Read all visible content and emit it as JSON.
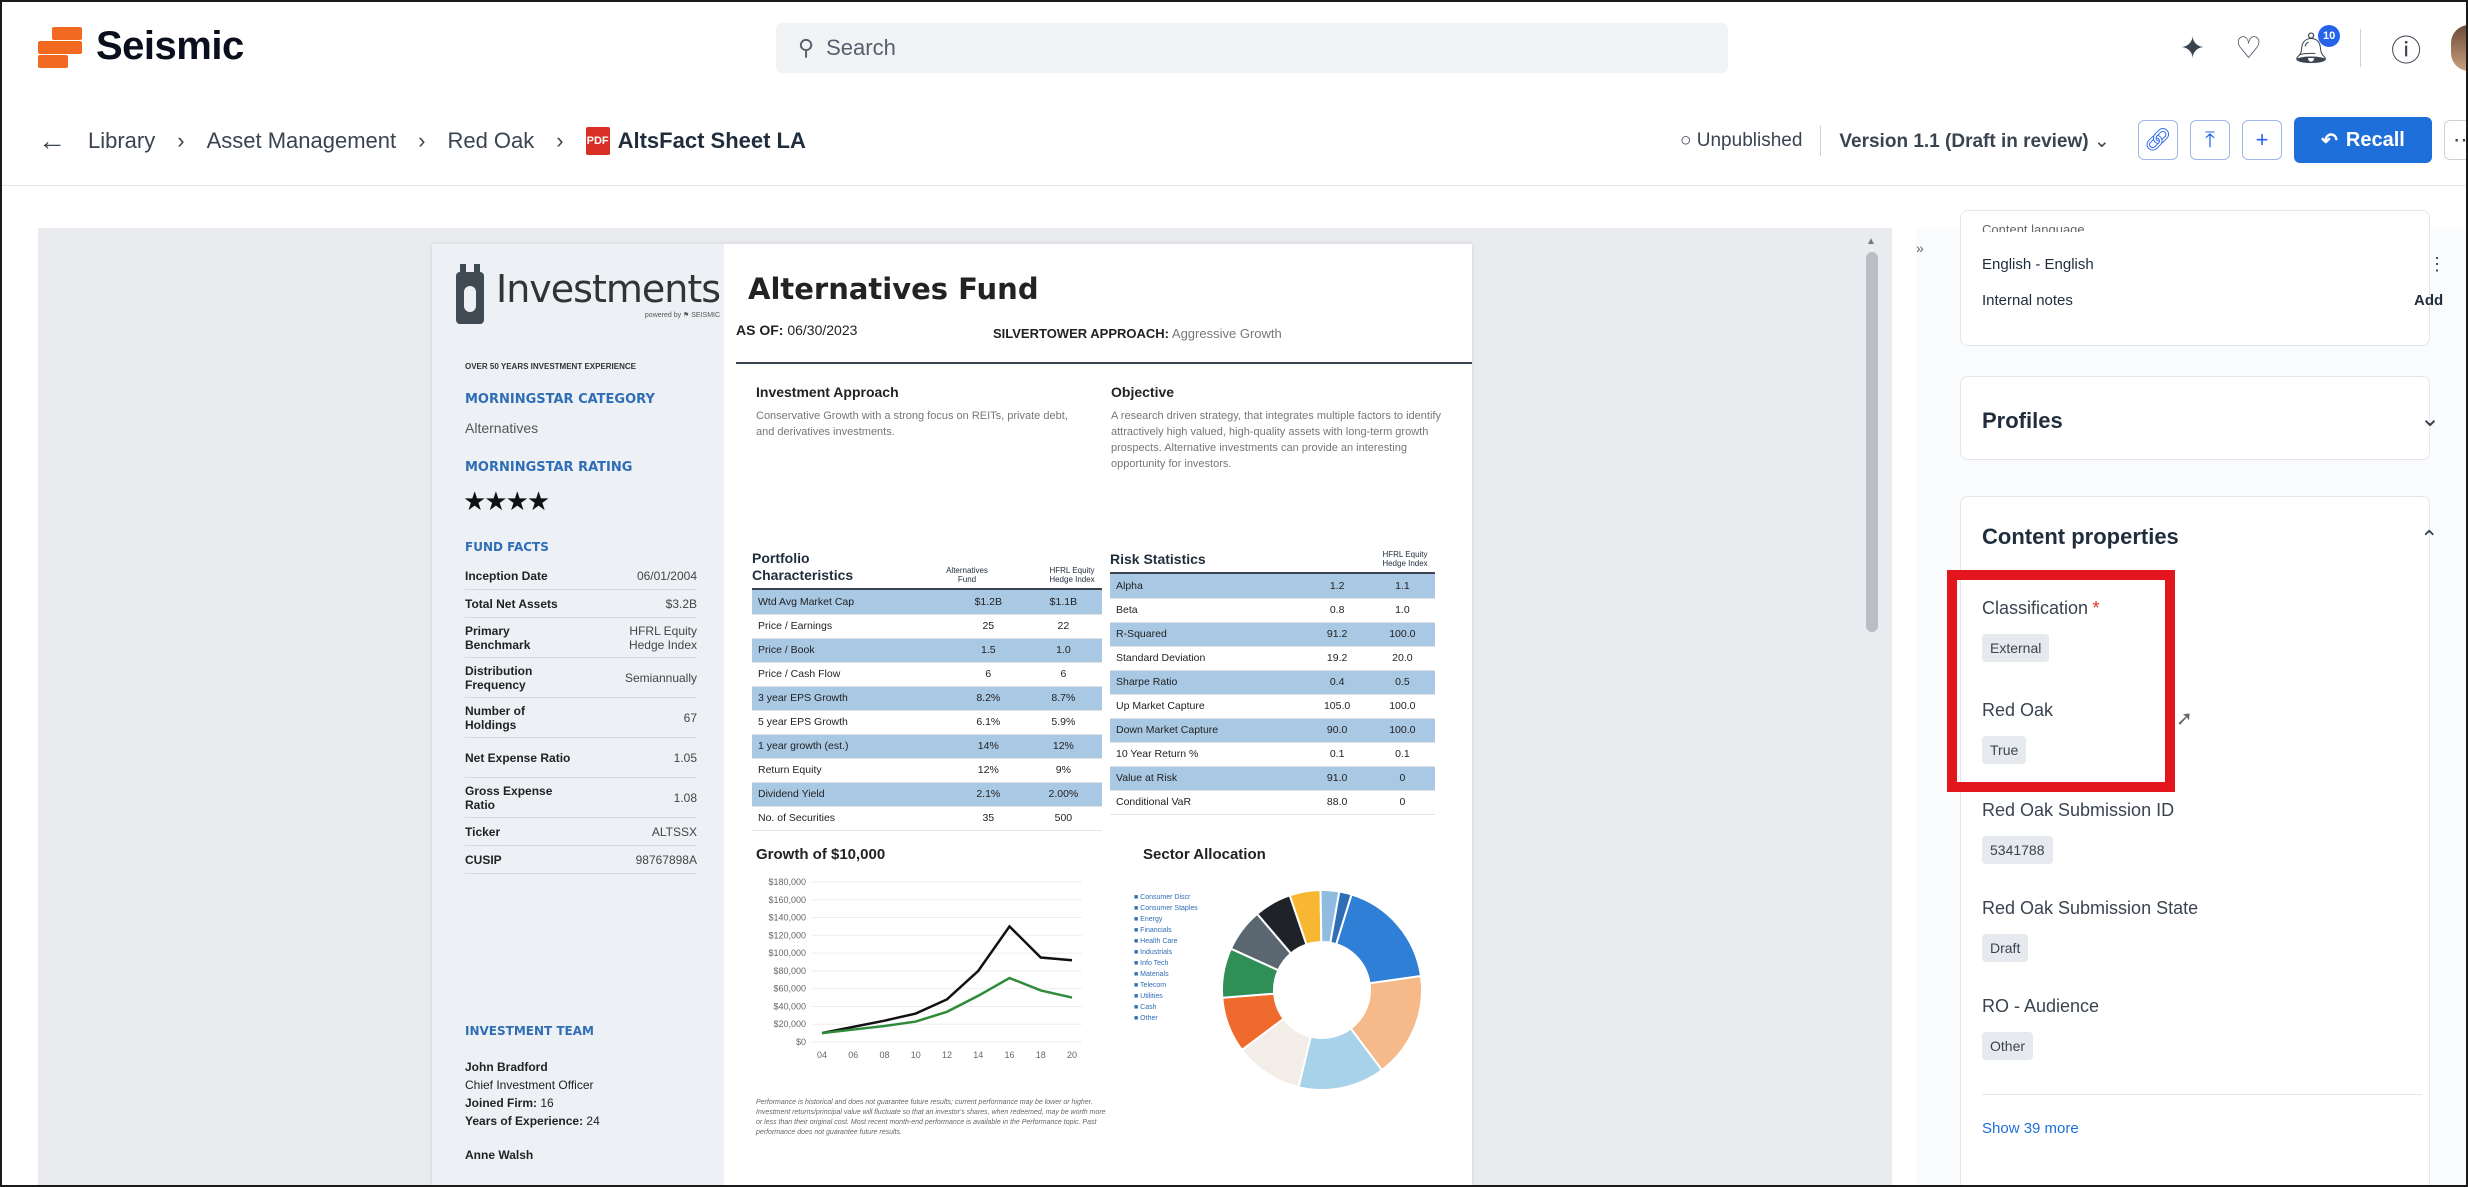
{
  "app": {
    "brand": "Seismic",
    "search_placeholder": "Search",
    "notif_count": "10"
  },
  "breadcrumb": [
    "Library",
    "Asset Management",
    "Red Oak"
  ],
  "document": {
    "title": "AltsFact Sheet LA",
    "status": "Unpublished",
    "version": "Version 1.1 (Draft in review)"
  },
  "toolbar": {
    "recall": "Recall"
  },
  "sheet": {
    "brand": "Investments",
    "brand_sub": "powered by ⚑ SEISMIC",
    "title": "Alternatives Fund",
    "as_of_label": "AS OF:",
    "as_of": "06/30/2023",
    "approach_label": "SILVERTOWER APPROACH:",
    "approach": "Aggressive Growth",
    "experience": "OVER 50 YEARS INVESTMENT EXPERIENCE",
    "category_label": "MORNINGSTAR CATEGORY",
    "category": "Alternatives",
    "rating_label": "MORNINGSTAR RATING",
    "rating_stars": "★★★★",
    "facts_label": "FUND FACTS",
    "facts": [
      [
        "Inception Date",
        "06/01/2004"
      ],
      [
        "Total Net Assets",
        "$3.2B"
      ],
      [
        "Primary Benchmark",
        "HFRL Equity Hedge Index"
      ],
      [
        "Distribution Frequency",
        "Semiannually"
      ],
      [
        "Number of Holdings",
        "67"
      ],
      [
        "Net Expense Ratio",
        "1.05"
      ],
      [
        "Gross Expense Ratio",
        "1.08"
      ],
      [
        "Ticker",
        "ALTSSX"
      ],
      [
        "CUSIP",
        "98767898A"
      ]
    ],
    "team_label": "INVESTMENT TEAM",
    "team": [
      {
        "name": "John Bradford",
        "role": "Chief Investment Officer",
        "joined_label": "Joined Firm:",
        "joined": "16",
        "years_label": "Years of Experience:",
        "years": "24"
      },
      {
        "name": "Anne Walsh"
      }
    ],
    "approach_head": "Investment Approach",
    "approach_text": "Conservative Growth with a strong focus on REITs, private debt, and derivatives investments.",
    "objective_head": "Objective",
    "objective_text": "A research driven strategy, that integrates multiple factors to identify attractively high valued, high-quality assets with long-term growth prospects. Alternative investments can provide an interesting opportunity for investors.",
    "portfolio_head": "Portfolio Characteristics",
    "portfolio_cols": [
      "Alternatives Fund",
      "HFRL Equity Hedge Index"
    ],
    "portfolio_rows": [
      [
        "Wtd Avg Market Cap",
        "$1.2B",
        "$1.1B"
      ],
      [
        "Price / Earnings",
        "25",
        "22"
      ],
      [
        "Price / Book",
        "1.5",
        "1.0"
      ],
      [
        "Price / Cash Flow",
        "6",
        "6"
      ],
      [
        "3 year EPS Growth",
        "8.2%",
        "8.7%"
      ],
      [
        "5 year EPS Growth",
        "6.1%",
        "5.9%"
      ],
      [
        "1 year growth (est.)",
        "14%",
        "12%"
      ],
      [
        "Return Equity",
        "12%",
        "9%"
      ],
      [
        "Dividend Yield",
        "2.1%",
        "2.00%"
      ],
      [
        "No. of Securities",
        "35",
        "500"
      ]
    ],
    "risk_head": "Risk Statistics",
    "risk_col": "HFRL Equity Hedge Index",
    "risk_rows": [
      [
        "Alpha",
        "1.2",
        "1.1"
      ],
      [
        "Beta",
        "0.8",
        "1.0"
      ],
      [
        "R-Squared",
        "91.2",
        "100.0"
      ],
      [
        "Standard Deviation",
        "19.2",
        "20.0"
      ],
      [
        "Sharpe Ratio",
        "0.4",
        "0.5"
      ],
      [
        "Up Market Capture",
        "105.0",
        "100.0"
      ],
      [
        "Down Market Capture",
        "90.0",
        "100.0"
      ],
      [
        "10 Year Return %",
        "0.1",
        "0.1"
      ],
      [
        "Value at Risk",
        "91.0",
        "0"
      ],
      [
        "Conditional VaR",
        "88.0",
        "0"
      ]
    ],
    "growth_head": "Growth of $10,000",
    "sector_head": "Sector Allocation",
    "sector_legend": [
      "Consumer Discr",
      "Consumer Staples",
      "Energy",
      "Financials",
      "Health Care",
      "Industrials",
      "Info Tech",
      "Materials",
      "Telecom",
      "Utilities",
      "Cash",
      "Other"
    ],
    "disclaimer": "Performance is historical and does not guarantee future results; current performance may be lower or higher. Investment returns/principal value will fluctuate so that an investor's shares, when redeemed, may be worth more or less than their original cost. Most recent month-end performance is available in the Performance topic. Past performance does not guarantee future results."
  },
  "chart_data": [
    {
      "type": "line",
      "title": "Growth of $10,000",
      "x": [
        "04",
        "06",
        "08",
        "10",
        "12",
        "14",
        "16",
        "18",
        "20"
      ],
      "ylim": [
        0,
        180000
      ],
      "yticks": [
        "$180,000",
        "$160,000",
        "$140,000",
        "$120,000",
        "$100,000",
        "$80,000",
        "$60,000",
        "$40,000",
        "$20,000",
        "$0"
      ],
      "series": [
        {
          "values": [
            10000,
            17000,
            24000,
            32000,
            48000,
            80000,
            130000,
            95000,
            92000
          ],
          "color": "#111111"
        },
        {
          "values": [
            10000,
            14000,
            18000,
            23000,
            34000,
            52000,
            72000,
            58000,
            50000
          ],
          "color": "#2e8b3a"
        }
      ]
    },
    {
      "type": "pie",
      "title": "Sector Allocation",
      "values": [
        18,
        17,
        14,
        11,
        9,
        8,
        7,
        6,
        5,
        3,
        2
      ],
      "colors": [
        "#2f7fd6",
        "#f5b98a",
        "#a8d1ea",
        "#f2ede6",
        "#ef6a2d",
        "#2f8f57",
        "#5b6770",
        "#1f2329",
        "#f7b733",
        "#8fbce0",
        "#2f6db5"
      ]
    }
  ],
  "panel": {
    "lang_label": "Content language",
    "lang_value": "English - English",
    "notes_label": "Internal notes",
    "notes_action": "Add",
    "profiles": "Profiles",
    "content_props": "Content properties",
    "props": [
      {
        "label": "Classification",
        "required": "*",
        "value": "External"
      },
      {
        "label": "Red Oak",
        "value": "True"
      },
      {
        "label": "Red Oak Submission ID",
        "value": "5341788"
      },
      {
        "label": "Red Oak Submission State",
        "value": "Draft"
      },
      {
        "label": "RO - Audience",
        "value": "Other"
      }
    ],
    "show_more": "Show 39 more"
  }
}
